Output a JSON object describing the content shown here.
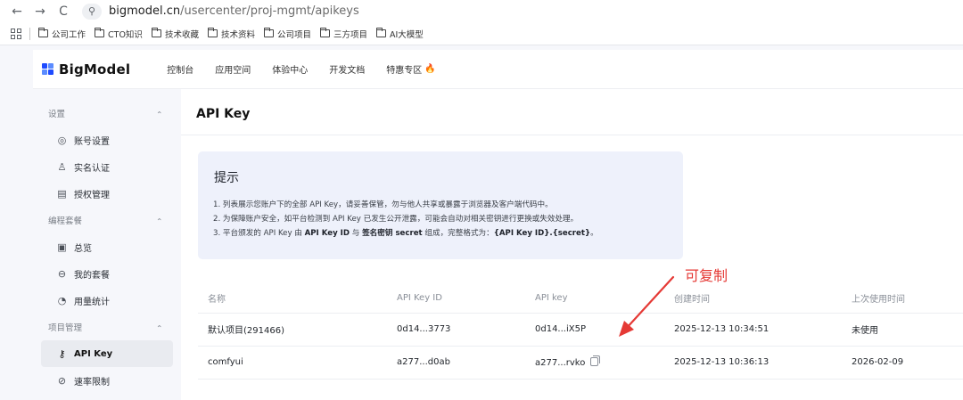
{
  "browser": {
    "url_host": "bigmodel.cn",
    "url_path": "/usercenter/proj-mgmt/apikeys",
    "back_glyph": "←",
    "forward_glyph": "→",
    "reload_glyph": "C",
    "site_info_glyph": "⚲"
  },
  "bookmarks": [
    {
      "label": "公司工作",
      "icon": "folder-icon"
    },
    {
      "label": "CTO知识",
      "icon": "folder-icon"
    },
    {
      "label": "技术收藏",
      "icon": "folder-icon"
    },
    {
      "label": "技术资料",
      "icon": "folder-icon"
    },
    {
      "label": "公司项目",
      "icon": "folder-icon"
    },
    {
      "label": "三方项目",
      "icon": "folder-icon"
    },
    {
      "label": "AI大模型",
      "icon": "folder-icon"
    }
  ],
  "header": {
    "brand": "BigModel",
    "nav": [
      "控制台",
      "应用空间",
      "体验中心",
      "开发文档",
      "特惠专区"
    ],
    "hot_icon": "flame-icon",
    "brand_colors": [
      "#1e4bff",
      "#5b8cff"
    ]
  },
  "sidebar": {
    "groups": [
      {
        "title": "设置",
        "items": [
          {
            "label": "账号设置",
            "icon": "account-settings-icon",
            "glyph": "◎"
          },
          {
            "label": "实名认证",
            "icon": "person-icon",
            "glyph": "♙"
          },
          {
            "label": "授权管理",
            "icon": "authorization-icon",
            "glyph": "▤"
          }
        ]
      },
      {
        "title": "编程套餐",
        "items": [
          {
            "label": "总览",
            "icon": "overview-icon",
            "glyph": "▣"
          },
          {
            "label": "我的套餐",
            "icon": "package-icon",
            "glyph": "⊖"
          },
          {
            "label": "用量统计",
            "icon": "usage-stats-icon",
            "glyph": "◔"
          }
        ]
      },
      {
        "title": "项目管理",
        "items": [
          {
            "label": "API Key",
            "icon": "key-icon",
            "glyph": "⚷",
            "active": true
          },
          {
            "label": "速率限制",
            "icon": "rate-limit-icon",
            "glyph": "⊘"
          }
        ]
      }
    ]
  },
  "main": {
    "title": "API Key",
    "tip": {
      "title": "提示",
      "line1": "1. 列表展示您账户下的全部 API Key，请妥善保管，勿与他人共享或暴露于浏览器及客户端代码中。",
      "line2": "2. 为保障账户安全，如平台检测到 API Key 已发生公开泄露，可能会自动对相关密钥进行更换或失效处理。",
      "line3_pre": "3. 平台颁发的 API Key 由 ",
      "line3_b1": "API Key ID",
      "line3_mid1": " 与 ",
      "line3_b2": "签名密钥 secret",
      "line3_mid2": " 组成，完整格式为：",
      "line3_b3": "{API Key ID}.{secret}",
      "line3_end": "。"
    },
    "annotation": "可复制",
    "table": {
      "headers": [
        "名称",
        "API Key ID",
        "API key",
        "创建时间",
        "上次使用时间"
      ],
      "rows": [
        {
          "name": "默认项目(291466)",
          "key_id": "0d14...3773",
          "key": "0d14...iX5P",
          "created": "2025-12-13 10:34:51",
          "last_used": "未使用"
        },
        {
          "name": "comfyui",
          "key_id": "a277...d0ab",
          "key": "a277...rvko",
          "created": "2025-12-13 10:36:13",
          "last_used": "2026-02-09"
        }
      ]
    }
  },
  "colors": {
    "annotation_red": "#e53935",
    "tip_bg": "#eef1fb",
    "hot": "#ff6a00"
  }
}
